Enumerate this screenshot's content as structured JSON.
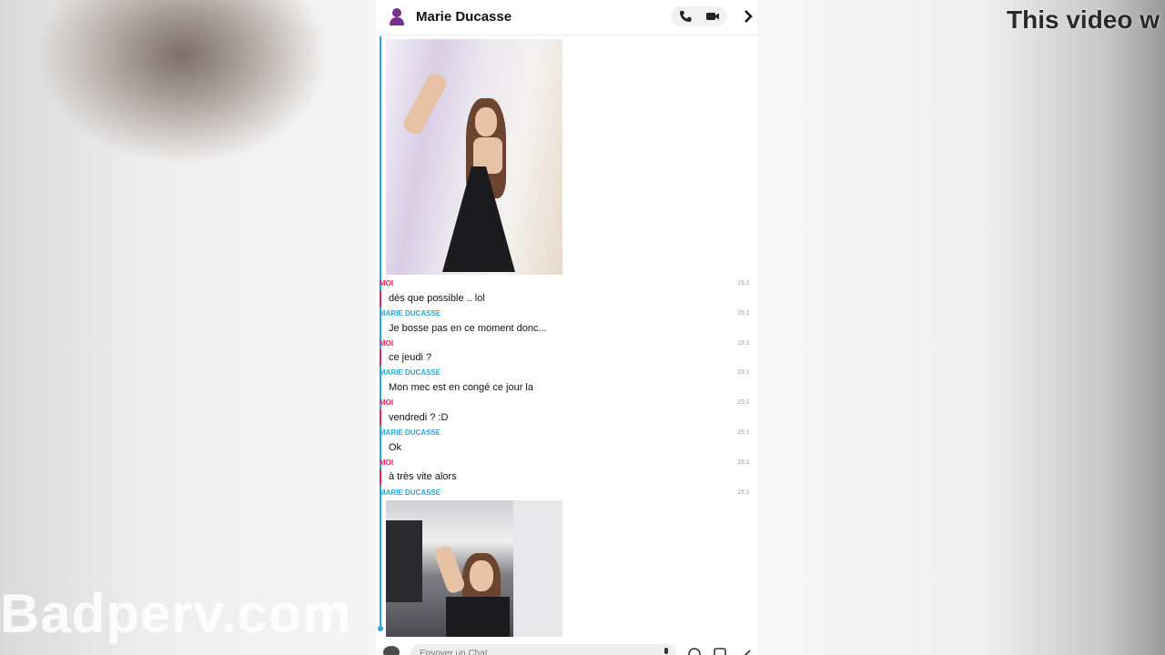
{
  "overlay": {
    "title": "This video w",
    "watermark": "Badperv.com"
  },
  "header": {
    "contact_name": "Marie Ducasse",
    "icons": [
      "bitmoji-avatar-icon",
      "phone-icon",
      "video-icon",
      "chevron-right-icon"
    ]
  },
  "messages": [
    {
      "sender": "MOI",
      "text": "dès que possible .. lol",
      "time": "15:1",
      "side": "me"
    },
    {
      "sender": "MARIE DUCASSE",
      "text": "Je bosse pas en ce moment donc...",
      "time": "15:1",
      "side": "her"
    },
    {
      "sender": "MOI",
      "text": "ce jeudi ?",
      "time": "15:1",
      "side": "me"
    },
    {
      "sender": "MARIE DUCASSE",
      "text": "Mon mec est en congé ce jour la",
      "time": "15:1",
      "side": "her"
    },
    {
      "sender": "MOI",
      "text": "vendredi ? :D",
      "time": "15:1",
      "side": "me"
    },
    {
      "sender": "MARIE DUCASSE",
      "text": "Ok",
      "time": "15:1",
      "side": "her"
    },
    {
      "sender": "MOI",
      "text": "à très vite alors",
      "time": "15:1",
      "side": "me"
    },
    {
      "sender": "MARIE DUCASSE",
      "text": "",
      "time": "15:1",
      "side": "her"
    }
  ],
  "colors": {
    "me_accent": "#e0245e",
    "her_accent": "#2aa6d8"
  },
  "input": {
    "placeholder": "Envoyer un Chat"
  }
}
